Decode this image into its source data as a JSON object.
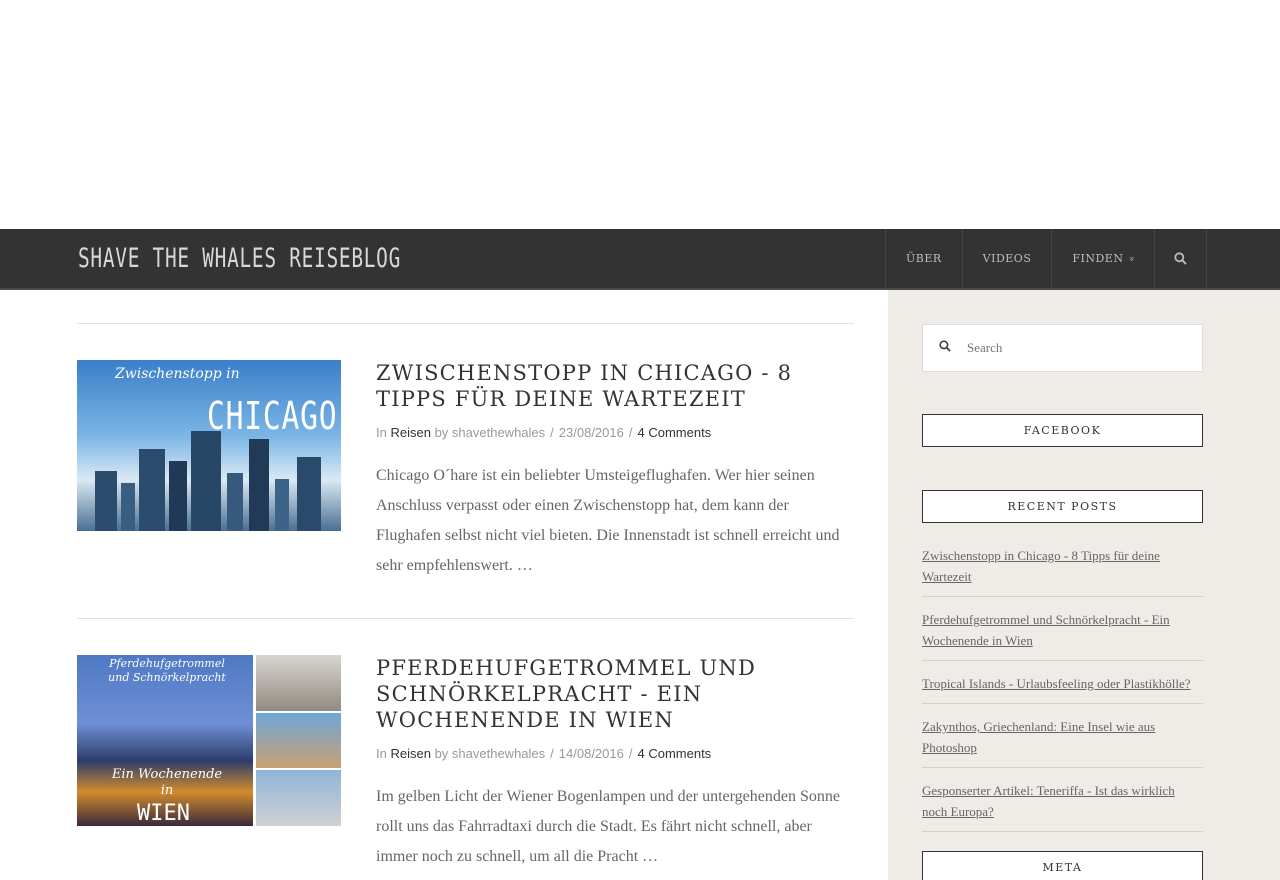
{
  "site": {
    "brand": "Shave the whales reiseblog"
  },
  "nav": {
    "items": [
      "Über",
      "Videos",
      "Finden"
    ],
    "finden_chevron": "»",
    "search_icon": "search-icon"
  },
  "posts": [
    {
      "title": "Zwischenstopp in Chicago - 8 Tipps für deine Wartezeit",
      "thumb_top": "Zwischenstopp in",
      "thumb_big": "CHICAGO",
      "meta": {
        "prefix": "In",
        "category": "Reisen",
        "by": "by",
        "author": "shavethewhales",
        "date": "23/08/2016",
        "comments": "4 Comments"
      },
      "excerpt": "Chicago O´hare ist ein beliebter Umsteigeflughafen. Wer hier seinen Anschluss verpasst oder einen Zwischenstopp   hat, dem kann der Flughafen selbst nicht viel bieten. Die Innenstadt ist schnell erreicht und sehr empfehlenswert. …"
    },
    {
      "title": "Pferdehufgetrommel und Schnörkelpracht - Ein Wochenende in Wien",
      "thumb_top": "Pferdehufgetrommel und Schnörkelpracht",
      "thumb_mid": "Ein Wochenende in",
      "thumb_big": "WIEN",
      "meta": {
        "prefix": "In",
        "category": "Reisen",
        "by": "by",
        "author": "shavethewhales",
        "date": "14/08/2016",
        "comments": "4 Comments"
      },
      "excerpt": "Im gelben Licht der Wiener Bogenlampen und der untergehenden Sonne rollt uns das Fahrradtaxi durch die Stadt. Es fährt nicht schnell, aber immer noch zu schnell, um all die Pracht …"
    }
  ],
  "sidebar": {
    "search_placeholder": "Search",
    "facebook_title": "Facebook",
    "recent_title": "Recent Posts",
    "recent_posts": [
      "Zwischenstopp in Chicago - 8 Tipps für deine Wartezeit",
      "Pferdehufgetrommel und Schnörkelpracht - Ein Wochenende in Wien",
      "Tropical Islands - Urlaubsfeeling oder Plastikhölle?",
      "Zakynthos, Griechenland: Eine Insel wie aus Photoshop",
      "Gesponserter Artikel: Teneriffa - Ist das wirklich noch Europa?"
    ],
    "meta_title": "Meta"
  }
}
